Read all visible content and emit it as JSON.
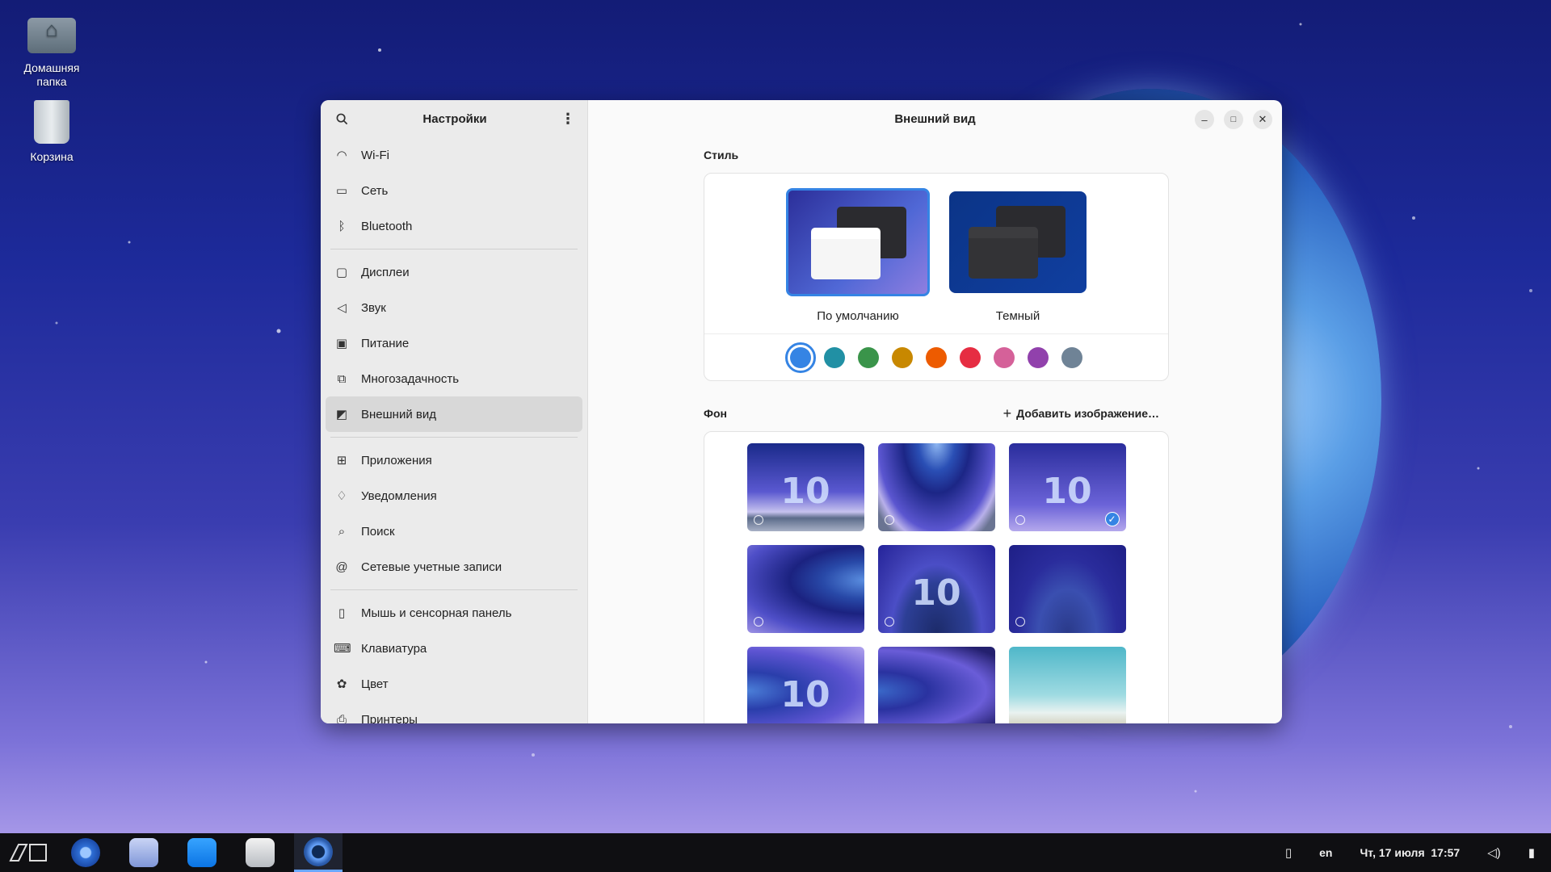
{
  "desktop": {
    "icons": [
      {
        "label": "Домашняя папка"
      },
      {
        "label": "Корзина"
      }
    ]
  },
  "sidebar": {
    "title": "Настройки",
    "groups": [
      [
        {
          "label": "Wi-Fi",
          "icon": "wifi-icon"
        },
        {
          "label": "Сеть",
          "icon": "network-icon"
        },
        {
          "label": "Bluetooth",
          "icon": "bluetooth-icon"
        }
      ],
      [
        {
          "label": "Дисплеи",
          "icon": "display-icon"
        },
        {
          "label": "Звук",
          "icon": "speaker-icon"
        },
        {
          "label": "Питание",
          "icon": "power-icon"
        },
        {
          "label": "Многозадачность",
          "icon": "multitasking-icon"
        },
        {
          "label": "Внешний вид",
          "icon": "appearance-icon",
          "active": true
        }
      ],
      [
        {
          "label": "Приложения",
          "icon": "apps-icon"
        },
        {
          "label": "Уведомления",
          "icon": "bell-icon"
        },
        {
          "label": "Поиск",
          "icon": "search-icon"
        },
        {
          "label": "Сетевые учетные записи",
          "icon": "at-icon"
        }
      ],
      [
        {
          "label": "Мышь и сенсорная панель",
          "icon": "mouse-icon"
        },
        {
          "label": "Клавиатура",
          "icon": "keyboard-icon"
        },
        {
          "label": "Цвет",
          "icon": "color-icon"
        },
        {
          "label": "Принтеры",
          "icon": "printer-icon"
        }
      ]
    ]
  },
  "main": {
    "title": "Внешний вид",
    "style_label": "Стиль",
    "styles": [
      {
        "label": "По умолчанию",
        "selected": true
      },
      {
        "label": "Темный",
        "selected": false
      }
    ],
    "accents": [
      "#3584e4",
      "#2190a4",
      "#3a944a",
      "#c88800",
      "#ed5b00",
      "#e62d42",
      "#d56199",
      "#9141ac",
      "#6f8396"
    ],
    "selected_accent": 0,
    "background_label": "Фон",
    "add_image_label": "Добавить изображение…",
    "wallpapers": [
      {
        "tenx": "10",
        "selected": false
      },
      {
        "tenx": "",
        "selected": false
      },
      {
        "tenx": "10",
        "selected": true
      },
      {
        "tenx": "",
        "selected": false
      },
      {
        "tenx": "10",
        "selected": false
      },
      {
        "tenx": "",
        "selected": false
      },
      {
        "tenx": "10",
        "selected": false
      },
      {
        "tenx": "",
        "selected": false
      },
      {
        "tenx": "",
        "selected": false
      }
    ]
  },
  "taskbar": {
    "lang": "en",
    "datetime": "Чт, 17 июля  17:57"
  }
}
